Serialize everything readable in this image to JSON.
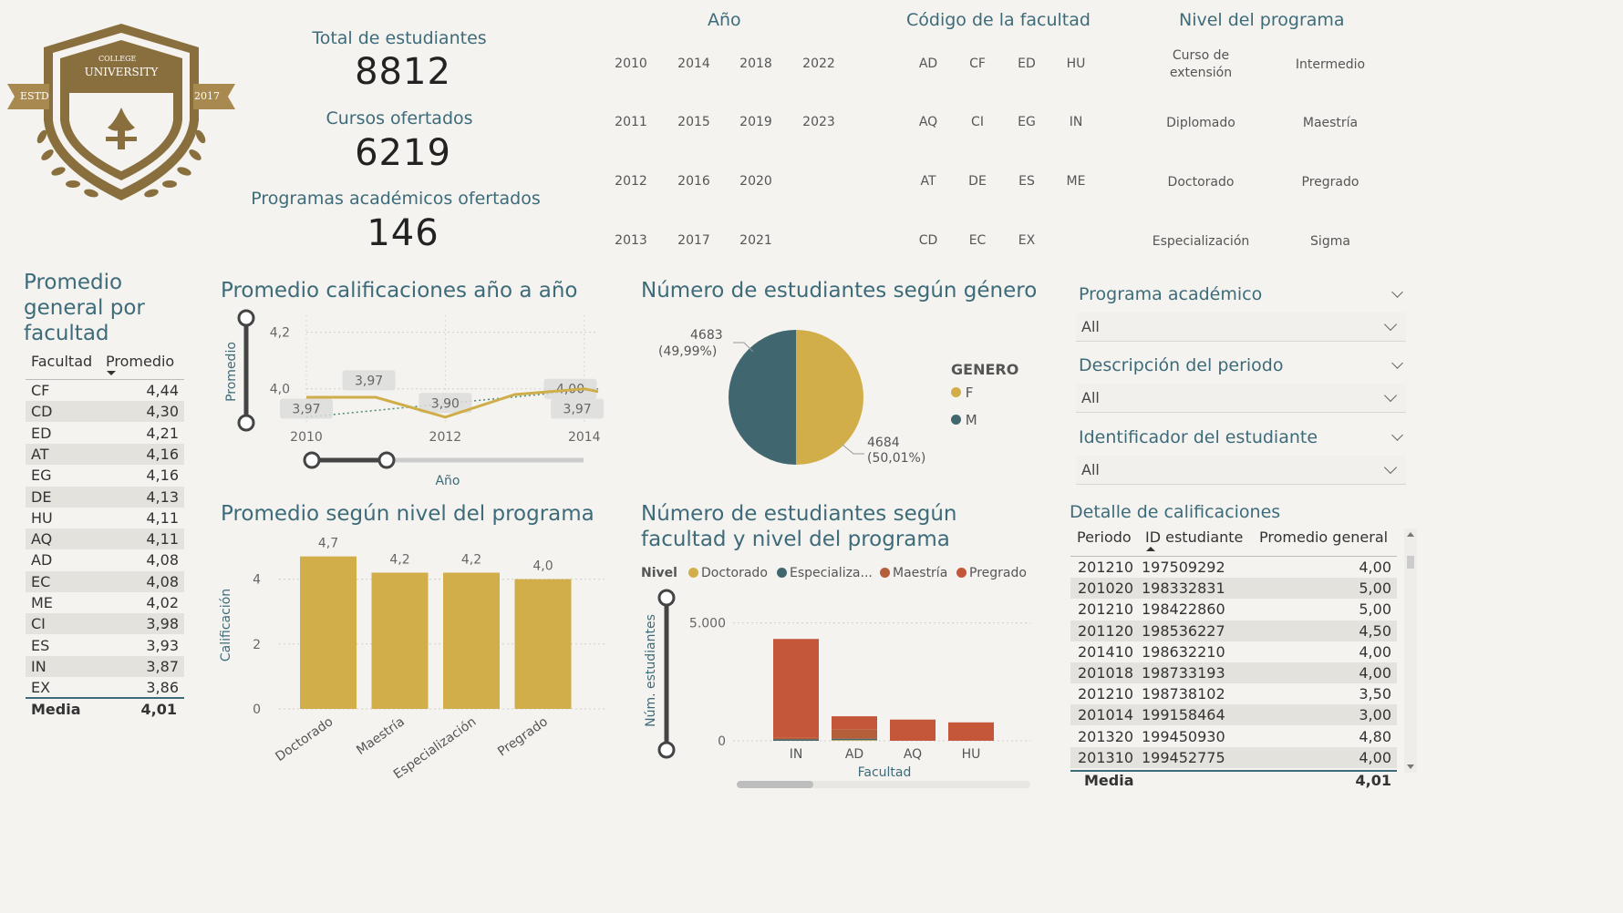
{
  "logo": {
    "top_text": "COLLEGE",
    "name": "UNIVERSITY",
    "left_text": "ESTD",
    "right_text": "2017"
  },
  "kpis": [
    {
      "label": "Total de estudiantes",
      "value": "8812"
    },
    {
      "label": "Cursos ofertados",
      "value": "6219"
    },
    {
      "label": "Programas académicos ofertados",
      "value": "146"
    }
  ],
  "slicers": {
    "anio": {
      "title": "Año",
      "items": [
        "2010",
        "2014",
        "2018",
        "2022",
        "2011",
        "2015",
        "2019",
        "2023",
        "2012",
        "2016",
        "2020",
        "2013",
        "2017",
        "2021"
      ]
    },
    "facultad": {
      "title": "Código de la facultad",
      "items": [
        "AD",
        "CF",
        "ED",
        "HU",
        "AQ",
        "CI",
        "EG",
        "IN",
        "AT",
        "DE",
        "ES",
        "ME",
        "CD",
        "EC",
        "EX"
      ]
    },
    "nivel": {
      "title": "Nivel del programa",
      "items": [
        "Curso de\nextensión",
        "Intermedio",
        "Diplomado",
        "Maestría",
        "Doctorado",
        "Pregrado",
        "Especialización",
        "Sigma"
      ]
    }
  },
  "promedio_tabla": {
    "title": "Promedio general por facultad",
    "headers": [
      "Facultad",
      "Promedio"
    ],
    "rows": [
      [
        "CF",
        "4,44"
      ],
      [
        "CD",
        "4,30"
      ],
      [
        "ED",
        "4,21"
      ],
      [
        "AT",
        "4,16"
      ],
      [
        "EG",
        "4,16"
      ],
      [
        "DE",
        "4,13"
      ],
      [
        "HU",
        "4,11"
      ],
      [
        "AQ",
        "4,11"
      ],
      [
        "AD",
        "4,08"
      ],
      [
        "EC",
        "4,08"
      ],
      [
        "ME",
        "4,02"
      ],
      [
        "CI",
        "3,98"
      ],
      [
        "ES",
        "3,93"
      ],
      [
        "IN",
        "3,87"
      ],
      [
        "EX",
        "3,86"
      ]
    ],
    "total": [
      "Media",
      "4,01"
    ]
  },
  "line_chart": {
    "title": "Promedio calificaciones año a año",
    "ylabel": "Promedio",
    "xlabel": "Año"
  },
  "pie_chart": {
    "title": "Número de estudiantes según género",
    "legend_title": "GENERO",
    "m_label_1": "4683",
    "m_label_2": "(49,99%)",
    "f_label_1": "4684",
    "f_label_2": "(50,01%)"
  },
  "bar_chart": {
    "title": "Promedio según nivel del programa",
    "ylabel": "Calificación"
  },
  "stack_chart": {
    "title_line1": "Número de estudiantes según",
    "title_line2": "facultad y nivel del programa",
    "legend_title": "Nivel",
    "ylabel": "Núm. estudiantes",
    "xlabel": "Facultad"
  },
  "dropdowns": [
    {
      "label": "Programa académico",
      "value": "All"
    },
    {
      "label": "Descripción del periodo",
      "value": "All"
    },
    {
      "label": "Identificador del estudiante",
      "value": "All"
    }
  ],
  "detalle": {
    "title": "Detalle de calificaciones",
    "headers": [
      "Periodo",
      "ID estudiante",
      "Promedio general"
    ],
    "rows": [
      [
        "201210",
        "197509292",
        "4,00"
      ],
      [
        "201020",
        "198332831",
        "5,00"
      ],
      [
        "201210",
        "198422860",
        "5,00"
      ],
      [
        "201120",
        "198536227",
        "4,50"
      ],
      [
        "201410",
        "198632210",
        "4,00"
      ],
      [
        "201018",
        "198733193",
        "4,00"
      ],
      [
        "201210",
        "198738102",
        "3,50"
      ],
      [
        "201014",
        "199158464",
        "3,00"
      ],
      [
        "201320",
        "199450930",
        "4,80"
      ],
      [
        "201310",
        "199452775",
        "4,00"
      ]
    ],
    "total": [
      "Media",
      "4,01"
    ]
  },
  "chart_data": [
    {
      "type": "line",
      "title": "Promedio calificaciones año a año",
      "xlabel": "Año",
      "ylabel": "Promedio",
      "x_ticks": [
        "2010",
        "2012",
        "2014"
      ],
      "y_ticks": [
        "4,0",
        "4,2"
      ],
      "ylim": [
        3.88,
        4.26
      ],
      "xlim": [
        2010,
        2014.2
      ],
      "series": [
        {
          "x": [
            2010,
            2011,
            2012,
            2013,
            2014,
            2014.2
          ],
          "values": [
            3.97,
            3.97,
            3.9,
            3.98,
            4.0,
            3.99
          ],
          "color": "#cfae4a"
        }
      ],
      "trend": {
        "x": [
          2010,
          2014.2
        ],
        "values": [
          3.9,
          4.0
        ],
        "color": "#4f8a7a"
      },
      "data_labels": [
        {
          "x": 2010,
          "y": 3.93,
          "text": "3,97"
        },
        {
          "x": 2010.9,
          "y": 4.03,
          "text": "3,97"
        },
        {
          "x": 2012,
          "y": 3.95,
          "text": "3,90"
        },
        {
          "x": 2013.8,
          "y": 4.0,
          "text": "4,00"
        },
        {
          "x": 2013.9,
          "y": 3.93,
          "text": "3,97"
        }
      ]
    },
    {
      "type": "pie",
      "title": "Número de estudiantes según género",
      "legend_title": "GENERO",
      "categories": [
        "F",
        "M"
      ],
      "values": [
        4684,
        4683
      ],
      "colors": [
        "#d1ae4a",
        "#40666f"
      ]
    },
    {
      "type": "bar",
      "title": "Promedio según nivel del programa",
      "ylabel": "Calificación",
      "categories": [
        "Doctorado",
        "Maestría",
        "Especialización",
        "Pregrado"
      ],
      "values": [
        4.7,
        4.2,
        4.2,
        4.0
      ],
      "labels": [
        "4,7",
        "4,2",
        "4,2",
        "4,0"
      ],
      "y_ticks": [
        0,
        2,
        4
      ],
      "ylim": [
        0,
        5
      ],
      "color": "#d1ae4a"
    },
    {
      "type": "bar",
      "stacked": true,
      "title": "Número de estudiantes según facultad y nivel del programa",
      "xlabel": "Facultad",
      "ylabel": "Núm. estudiantes",
      "categories": [
        "IN",
        "AD",
        "AQ",
        "HU"
      ],
      "y_ticks": [
        "0",
        "5.000"
      ],
      "ylim": [
        0,
        6300
      ],
      "series": [
        {
          "name": "Doctorado",
          "values": [
            0,
            30,
            0,
            0
          ],
          "color": "#d1ae4a"
        },
        {
          "name": "Especializa...",
          "values": [
            60,
            60,
            0,
            0
          ],
          "color": "#40666f"
        },
        {
          "name": "Maestría",
          "values": [
            60,
            400,
            0,
            0
          ],
          "color": "#b55e3a"
        },
        {
          "name": "Pregrado",
          "values": [
            4200,
            550,
            900,
            780
          ],
          "color": "#c4573a"
        }
      ]
    }
  ]
}
